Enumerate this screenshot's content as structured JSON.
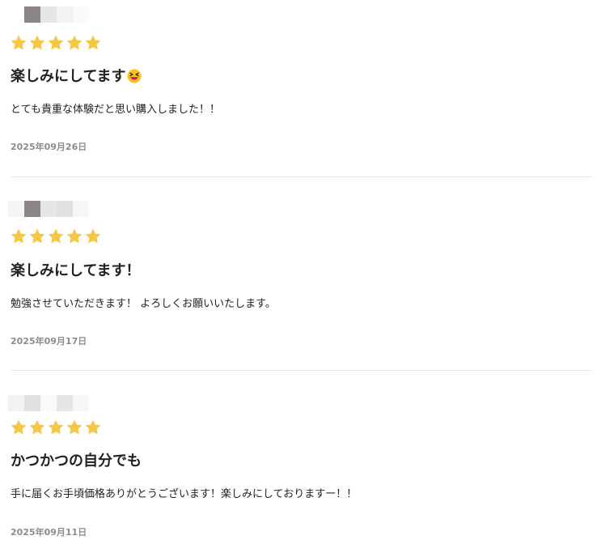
{
  "reviews": [
    {
      "rating": 5,
      "title": "楽しみにしてます",
      "title_emoji": "laughing-squinting-emoji",
      "body": "とても貴重な体験だと思い購入しました！！",
      "date": "2025年09月26日"
    },
    {
      "rating": 5,
      "title": "楽しみにしてます！",
      "body": "勉強させていただきます！ よろしくお願いいたします。",
      "date": "2025年09月17日"
    },
    {
      "rating": 5,
      "title": "かつかつの自分でも",
      "body": "手に届くお手頃価格ありがとうございます！楽しみにしておりますー！！",
      "date": "2025年09月11日"
    }
  ],
  "icons": {
    "star": "star-icon",
    "avatar": "pixelated-avatar"
  },
  "colors": {
    "star": "#f6c744",
    "date": "#8c8c8c",
    "divider": "#e8e8e8",
    "text": "#222222"
  }
}
